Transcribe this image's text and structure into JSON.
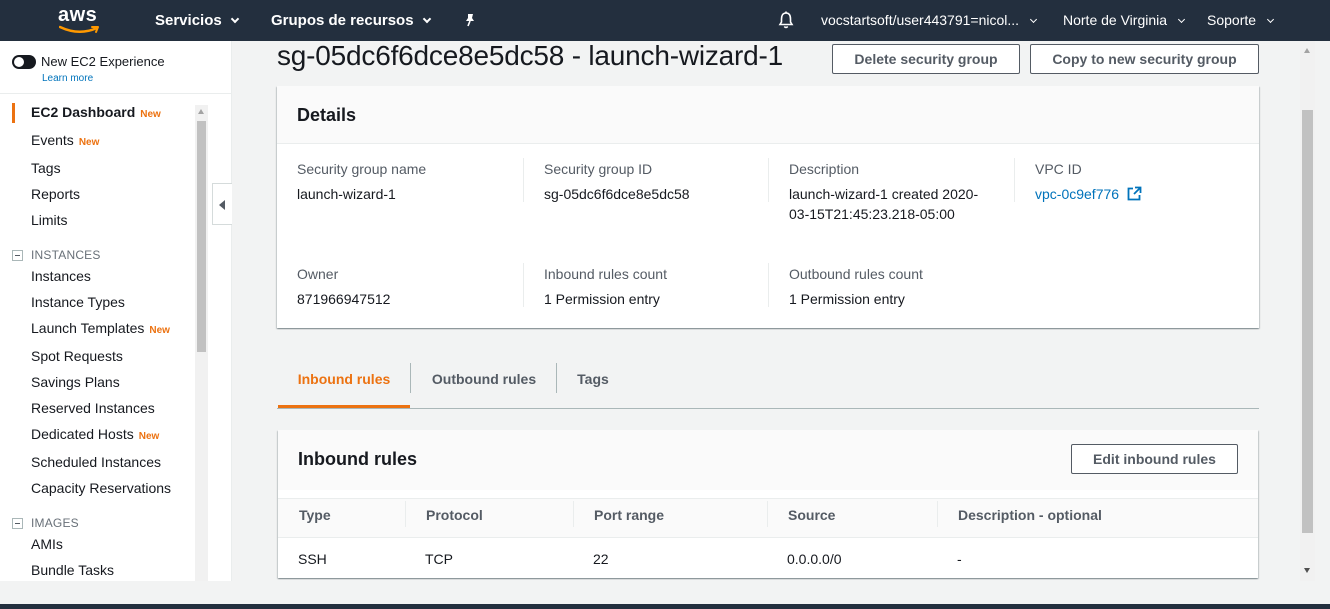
{
  "topnav": {
    "logo_text": "aws",
    "services": "Servicios",
    "resource_groups": "Grupos de recursos",
    "account": "vocstartsoft/user443791=nicol...",
    "region": "Norte de Virginia",
    "support": "Soporte",
    "bg_color": "#232f3e"
  },
  "sidebar": {
    "toggle_label": "New EC2 Experience",
    "learn_more": "Learn more",
    "new_tag": "New",
    "items": [
      {
        "label": "EC2 Dashboard",
        "new": true,
        "active": true
      },
      {
        "label": "Events",
        "new": true
      },
      {
        "label": "Tags"
      },
      {
        "label": "Reports"
      },
      {
        "label": "Limits"
      }
    ],
    "sections": [
      {
        "title": "INSTANCES",
        "items": [
          {
            "label": "Instances"
          },
          {
            "label": "Instance Types"
          },
          {
            "label": "Launch Templates",
            "new": true
          },
          {
            "label": "Spot Requests"
          },
          {
            "label": "Savings Plans"
          },
          {
            "label": "Reserved Instances"
          },
          {
            "label": "Dedicated Hosts",
            "new": true
          },
          {
            "label": "Scheduled Instances"
          },
          {
            "label": "Capacity Reservations"
          }
        ]
      },
      {
        "title": "IMAGES",
        "items": [
          {
            "label": "AMIs"
          },
          {
            "label": "Bundle Tasks"
          }
        ]
      }
    ]
  },
  "page": {
    "title": "sg-05dc6f6dce8e5dc58 - launch-wizard-1",
    "delete_button": "Delete security group",
    "copy_button": "Copy to new security group"
  },
  "details": {
    "title": "Details",
    "fields": [
      {
        "label": "Security group name",
        "value": "launch-wizard-1"
      },
      {
        "label": "Security group ID",
        "value": "sg-05dc6f6dce8e5dc58"
      },
      {
        "label": "Description",
        "value_line1": "launch-wizard-1 created 2020-",
        "value_line2": "03-15T21:45:23.218-05:00"
      },
      {
        "label": "VPC ID",
        "value": "vpc-0c9ef776"
      },
      {
        "label": "Owner",
        "value": "871966947512"
      },
      {
        "label": "Inbound rules count",
        "value": "1 Permission entry"
      },
      {
        "label": "Outbound rules count",
        "value": "1 Permission entry"
      }
    ]
  },
  "tabs": [
    {
      "label": "Inbound rules",
      "active": true
    },
    {
      "label": "Outbound rules"
    },
    {
      "label": "Tags"
    }
  ],
  "inbound": {
    "title": "Inbound rules",
    "edit_button": "Edit inbound rules",
    "columns": [
      "Type",
      "Protocol",
      "Port range",
      "Source",
      "Description - optional"
    ],
    "rows": [
      [
        "SSH",
        "TCP",
        "22",
        "0.0.0.0/0",
        "-"
      ]
    ]
  },
  "colors": {
    "accent": "#ec7211",
    "link": "#0073bb"
  }
}
